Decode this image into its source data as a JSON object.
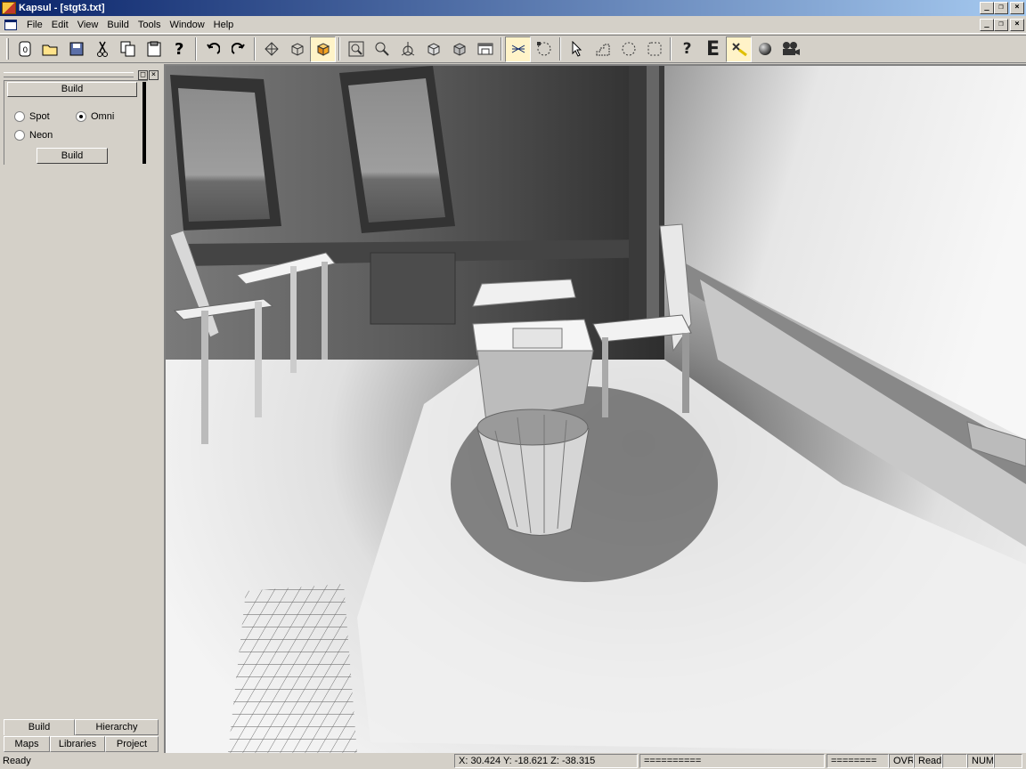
{
  "window": {
    "title": "Kapsul - [stgt3.txt]"
  },
  "menu": [
    "File",
    "Edit",
    "View",
    "Build",
    "Tools",
    "Window",
    "Help"
  ],
  "toolbar": {
    "icons": [
      "new-icon",
      "open-icon",
      "save-icon",
      "cut-icon",
      "copy-icon",
      "paste-icon",
      "help-cursor-icon",
      "undo-icon",
      "redo-icon",
      "wireframe-icon",
      "box-icon",
      "solid-box-icon",
      "zoom-extents-icon",
      "zoom-icon",
      "axis-icon",
      "front-view-icon",
      "top-view-icon",
      "window-icon",
      "snap-icon",
      "select-region-icon",
      "pointer-icon",
      "stairs-icon",
      "circle-icon",
      "rectangle-icon",
      "question-icon",
      "entity-icon",
      "light-icon",
      "sphere-icon",
      "camera-icon"
    ],
    "entity_glyph": "E",
    "question_glyph": "?"
  },
  "left_panel": {
    "header_button": "Build",
    "radios": [
      {
        "label": "Spot",
        "checked": false
      },
      {
        "label": "Omni",
        "checked": true
      },
      {
        "label": "Neon",
        "checked": false
      }
    ],
    "build_button": "Build",
    "tabs_top": [
      "Build",
      "Hierarchy"
    ],
    "tabs_bottom": [
      "Maps",
      "Libraries",
      "Project"
    ]
  },
  "status": {
    "ready": "Ready",
    "coords": "X:  30.424 Y: -18.621  Z: -38.315",
    "field_a": "==========",
    "field_b": "========",
    "ovr": "OVR",
    "read": "Read",
    "num": "NUM"
  }
}
